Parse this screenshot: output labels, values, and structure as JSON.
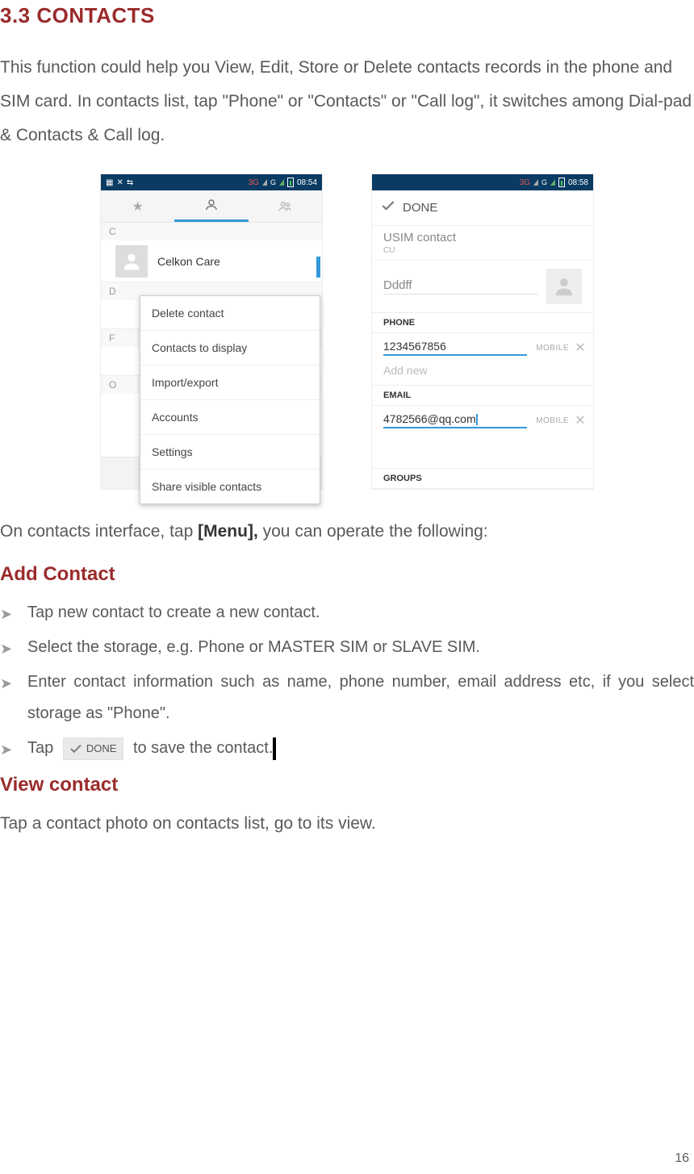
{
  "section_title": "3.3 CONTACTS",
  "intro": "This function could help you View, Edit, Store or Delete contacts records in the phone and SIM card. In contacts list, tap \"Phone\" or \"Contacts\" or \"Call log\", it switches among Dial-pad & Contacts & Call log.",
  "shot_a": {
    "status_3g": "3G",
    "time": "08:54",
    "divider_c": "C",
    "contact_c": "Celkon Care",
    "divider_d": "D",
    "divider_f": "F",
    "divider_o": "O",
    "menu": [
      "Delete contact",
      "Contacts to display",
      "Import/export",
      "Accounts",
      "Settings",
      "Share visible contacts"
    ]
  },
  "shot_b": {
    "status_3g": "3G",
    "time": "08:58",
    "done": "DONE",
    "usim_title": "USIM contact",
    "usim_sub": "CU",
    "name": "Dddff",
    "phone_label": "PHONE",
    "phone_num": "1234567856",
    "field_type": "MOBILE",
    "add_new": "Add new",
    "email_label": "EMAIL",
    "email": "4782566@qq.com",
    "groups_label": "GROUPS"
  },
  "para_after_before": "On contacts interface, tap ",
  "para_after_bold": "[Menu],",
  "para_after_after": " you can operate the following:",
  "add_contact_head": "Add Contact",
  "bullets": [
    "Tap new contact to create a new contact.",
    "Select the storage, e.g. Phone or MASTER SIM or SLAVE SIM.",
    "Enter contact information such as name, phone number, email address etc, if you select storage as \"Phone\"."
  ],
  "bullet4_before": "Tap ",
  "bullet4_chip": "DONE",
  "bullet4_after": " to save the contact.",
  "view_contact_head": "View contact",
  "view_contact_text": "Tap a contact photo on contacts list, go to its view.",
  "page_num": "16"
}
